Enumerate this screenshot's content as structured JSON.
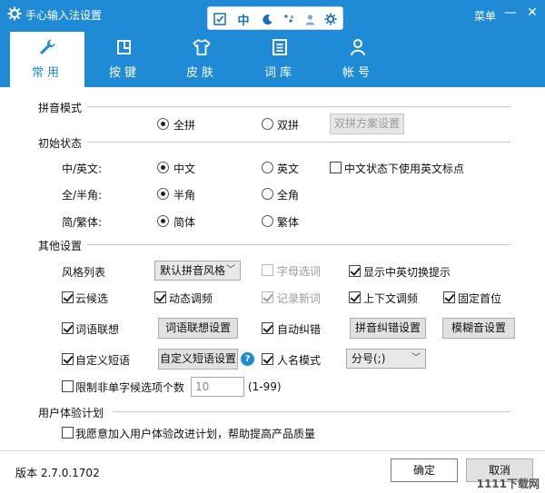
{
  "colors": {
    "accent": "#1f8ad6",
    "background": "#ffffff"
  },
  "window": {
    "title": "手心输入法设置",
    "menu_label": "菜单",
    "minimize_symbol": "—",
    "close_symbol": "✕",
    "status_toolbar": {
      "items": [
        "soft-keyboard-icon",
        "中",
        "moon-icon",
        "punctuation-icon",
        "user-icon",
        "gear-icon"
      ],
      "mode_label": "中"
    }
  },
  "tabs": [
    {
      "label": "常用",
      "icon": "wrench-icon",
      "active": true
    },
    {
      "label": "按键",
      "icon": "keyboard-key-icon",
      "active": false
    },
    {
      "label": "皮肤",
      "icon": "tshirt-icon",
      "active": false
    },
    {
      "label": "词库",
      "icon": "dictionary-icon",
      "active": false
    },
    {
      "label": "帐号",
      "icon": "person-icon",
      "active": false
    }
  ],
  "pinyin_mode": {
    "title": "拼音模式",
    "full": {
      "label": "全拼",
      "checked": true
    },
    "double": {
      "label": "双拼",
      "checked": false
    },
    "scheme_button": "双拼方案设置"
  },
  "initial_state": {
    "title": "初始状态",
    "lang": {
      "label": "中/英文:",
      "opt1": "中文",
      "opt2": "英文",
      "selected": "中文"
    },
    "english_punct": {
      "label": "中文状态下使用英文标点",
      "checked": false
    },
    "width": {
      "label": "全/半角:",
      "opt1": "半角",
      "opt2": "全角",
      "selected": "半角"
    },
    "script": {
      "label": "简/繁体:",
      "opt1": "简体",
      "opt2": "繁体",
      "selected": "简体"
    }
  },
  "other": {
    "title": "其他设置",
    "style_label": "风格列表",
    "style_value": "默认拼音风格",
    "letter_select": {
      "label": "字母选词",
      "checked": false,
      "disabled": true
    },
    "show_switch_tip": {
      "label": "显示中英切换提示",
      "checked": true
    },
    "cloud_candidates": {
      "label": "云候选",
      "checked": true
    },
    "dynamic_freq": {
      "label": "动态调频",
      "checked": true
    },
    "record_new_words": {
      "label": "记录新词",
      "checked": true,
      "disabled": true
    },
    "context_freq": {
      "label": "上下文调频",
      "checked": true
    },
    "fixed_first": {
      "label": "固定首位",
      "checked": true
    },
    "word_assoc": {
      "label": "词语联想",
      "checked": true
    },
    "word_assoc_button": "词语联想设置",
    "auto_correct": {
      "label": "自动纠错",
      "checked": true
    },
    "pinyin_correct_button": "拼音纠错设置",
    "fuzzy_button": "模糊音设置",
    "custom_phrase": {
      "label": "自定义短语",
      "checked": true
    },
    "custom_phrase_button": "自定义短语设置",
    "help_symbol": "?",
    "name_mode": {
      "label": "人名模式",
      "checked": true
    },
    "separator_value": "分号(;)",
    "limit": {
      "label": "限制非单字候选项个数",
      "checked": false,
      "value": "10",
      "range": "(1-99)"
    }
  },
  "ux": {
    "title": "用户体验计划",
    "join": {
      "label": "我愿意加入用户体验改进计划，帮助提高产品质量",
      "checked": false
    }
  },
  "footer": {
    "version": "版本 2.7.0.1702",
    "ok": "确定",
    "cancel": "取消",
    "watermark": "1111下载网"
  }
}
